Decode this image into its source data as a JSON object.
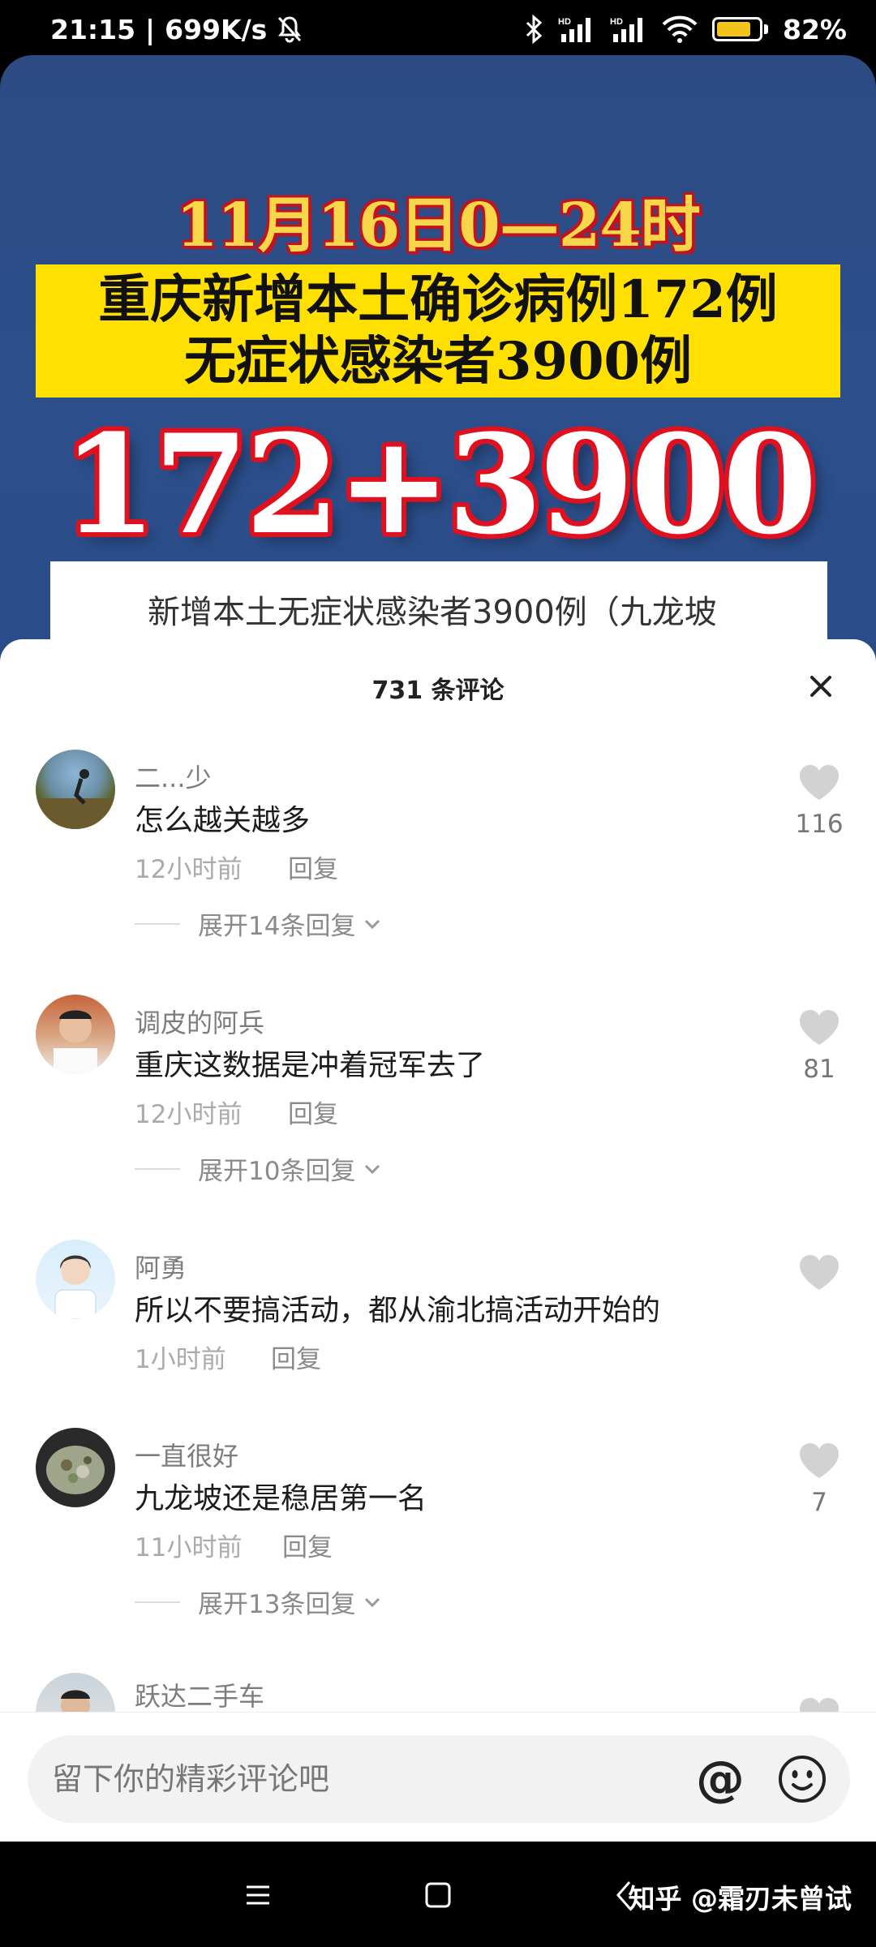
{
  "status_bar": {
    "time": "21:15",
    "net_speed": "699K/s",
    "battery_percent": "82%",
    "battery_level": 0.82,
    "icons": [
      "mute-bell-icon",
      "bluetooth-icon",
      "signal-hd-icon",
      "signal-hd-icon",
      "wifi-icon",
      "battery-icon"
    ]
  },
  "video": {
    "date_line": "11月16日0—24时",
    "headline_1": "重庆新增本土确诊病例172例",
    "headline_2": "无症状感染者3900例",
    "big_numbers": "172+3900",
    "caption": "新增本土无症状感染者3900例（九龙坡"
  },
  "comments_sheet": {
    "title": "731 条评论",
    "close_icon": "close-icon",
    "comments": [
      {
        "user": "二...少",
        "text": "怎么越关越多",
        "time": "12小时前",
        "reply": "回复",
        "likes": "116",
        "expand": "展开14条回复"
      },
      {
        "user": "调皮的阿兵",
        "text": "重庆这数据是冲着冠军去了",
        "time": "12小时前",
        "reply": "回复",
        "likes": "81",
        "expand": "展开10条回复"
      },
      {
        "user": "阿勇",
        "text": "所以不要搞活动，都从渝北搞活动开始的",
        "time": "1小时前",
        "reply": "回复",
        "likes": "",
        "expand": ""
      },
      {
        "user": "一直很好",
        "text": "九龙坡还是稳居第一名",
        "time": "11小时前",
        "reply": "回复",
        "likes": "7",
        "expand": "展开13条回复"
      },
      {
        "user": "跃达二手车",
        "text": "",
        "time": "",
        "reply": "",
        "likes": "",
        "expand": ""
      }
    ]
  },
  "input": {
    "placeholder": "留下你的精彩评论吧",
    "at_symbol": "@"
  },
  "nav_bar": {
    "watermark": "知乎 @霜刃未曾试"
  },
  "colors": {
    "accent_yellow": "#ffe000",
    "accent_red": "#e0101e",
    "video_blue": "#2c4f8b",
    "battery_yellow": "#f0c419"
  }
}
